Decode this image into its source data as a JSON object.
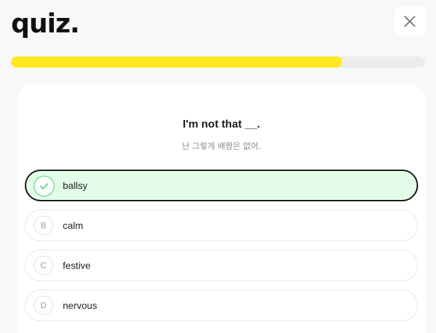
{
  "header": {
    "logo": "quiz."
  },
  "progress": {
    "fraction": 0.8
  },
  "question": {
    "text": "I'm not that __.",
    "translation": "난 그렇게 배짱은 없어."
  },
  "options": [
    {
      "badge": "",
      "label": "ballsy",
      "selected": true,
      "icon": "check-icon"
    },
    {
      "badge": "B",
      "label": "calm",
      "selected": false
    },
    {
      "badge": "C",
      "label": "festive",
      "selected": false
    },
    {
      "badge": "D",
      "label": "nervous",
      "selected": false
    }
  ],
  "colors": {
    "progress": "#ffe91f",
    "selected_bg": "#e2fce8",
    "check": "#3ecf6f"
  }
}
